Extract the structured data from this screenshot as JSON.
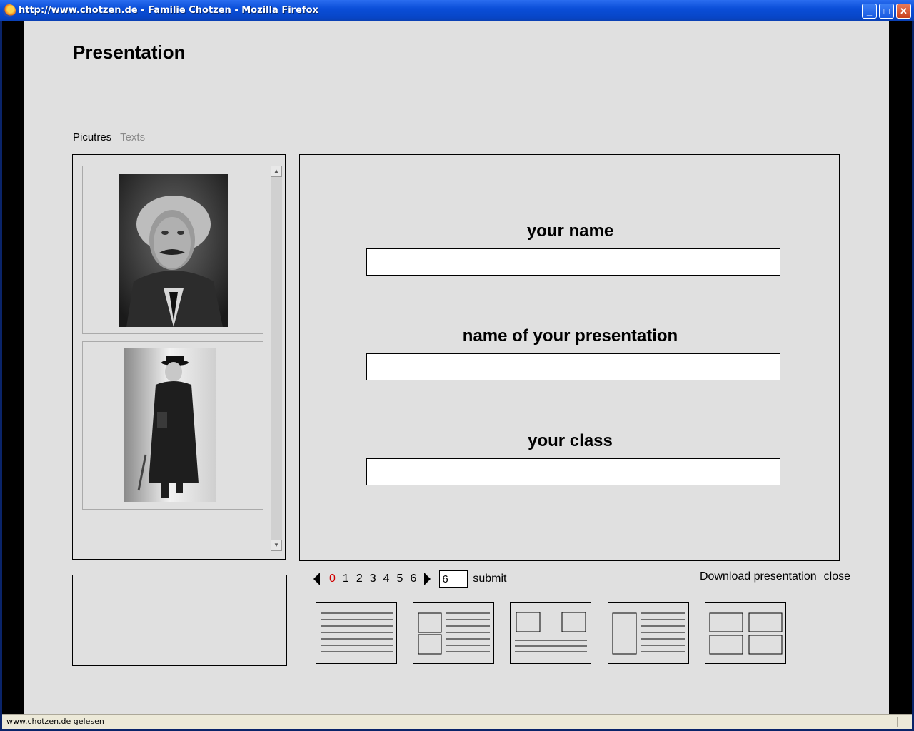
{
  "window": {
    "title": "http://www.chotzen.de - Familie Chotzen - Mozilla Firefox",
    "minimize_glyph": "_",
    "maximize_glyph": "□",
    "close_glyph": "✕"
  },
  "page": {
    "title": "Presentation",
    "tabs": [
      {
        "label": "Picutres",
        "active": true
      },
      {
        "label": "Texts",
        "active": false
      }
    ],
    "gallery": {
      "images": [
        {
          "alt": "portrait-photo"
        },
        {
          "alt": "walking-man-photo"
        }
      ]
    },
    "form": {
      "name_label": "your name",
      "name_value": "",
      "presentation_label": "name of your presentation",
      "presentation_value": "",
      "class_label": "your class",
      "class_value": ""
    },
    "pager": {
      "pages": [
        "0",
        "1",
        "2",
        "3",
        "4",
        "5",
        "6"
      ],
      "current": "0",
      "input_value": "6",
      "submit_label": "submit"
    },
    "actions": {
      "download_label": "Download presentation",
      "close_label": "close"
    },
    "layouts": [
      {
        "name": "text-only"
      },
      {
        "name": "two-images-left-text-right"
      },
      {
        "name": "two-images-top-text-bottom"
      },
      {
        "name": "tall-image-left-text-right"
      },
      {
        "name": "four-images"
      }
    ]
  },
  "statusbar": {
    "text": "www.chotzen.de gelesen"
  },
  "colors": {
    "page_bg": "#e0e0e0",
    "current_page": "#d00000",
    "inactive_tab": "#8a8a8a"
  }
}
